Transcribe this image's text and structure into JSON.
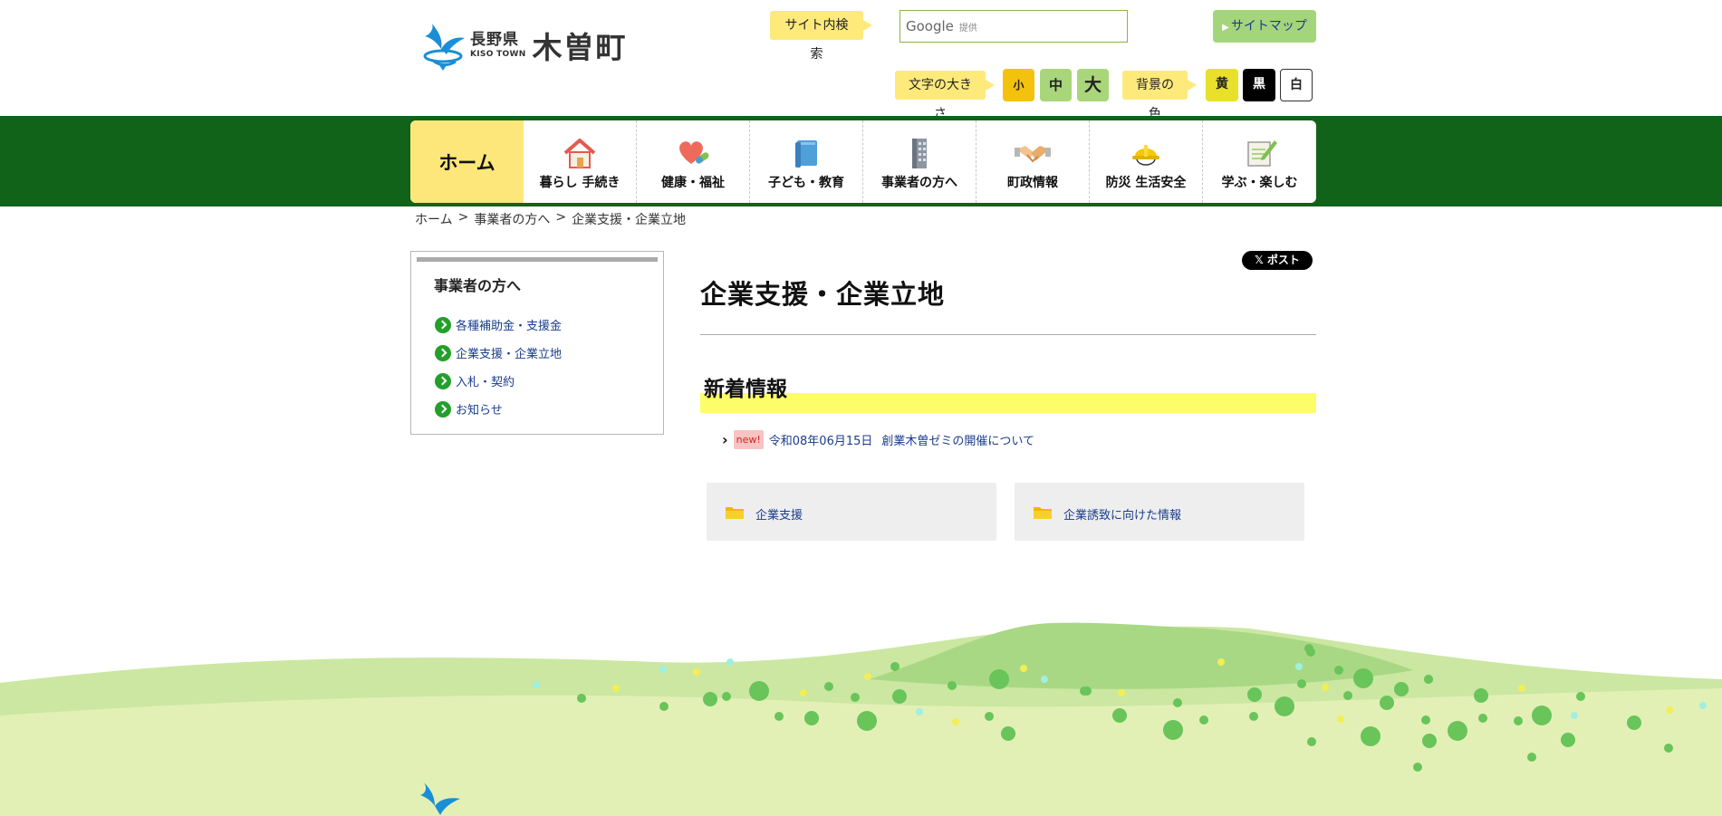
{
  "header": {
    "logo": {
      "prefecture": "長野県",
      "en": "KISO TOWN",
      "town": "木曽町"
    },
    "search": {
      "label": "サイト内検索",
      "google_text": "Google",
      "provided_text": "提供"
    },
    "sitemap_label": "サイトマップ",
    "font_size": {
      "label": "文字の大きさ",
      "small": "小",
      "medium": "中",
      "large": "大"
    },
    "background": {
      "label": "背景の色",
      "yellow": "黄",
      "black": "黒",
      "white": "白"
    }
  },
  "nav": {
    "home": "ホーム",
    "items": [
      {
        "label": "暮らし 手続き",
        "icon": "house-icon"
      },
      {
        "label": "健康・福祉",
        "icon": "heart-pill-icon"
      },
      {
        "label": "子ども・教育",
        "icon": "book-icon"
      },
      {
        "label": "事業者の方へ",
        "icon": "building-icon"
      },
      {
        "label": "町政情報",
        "icon": "handshake-icon"
      },
      {
        "label": "防災 生活安全",
        "icon": "helmet-icon"
      },
      {
        "label": "学ぶ・楽しむ",
        "icon": "notepad-pencil-icon"
      }
    ]
  },
  "breadcrumb": {
    "items": [
      "ホーム",
      "事業者の方へ",
      "企業支援・企業立地"
    ],
    "separator": ">"
  },
  "side": {
    "title": "事業者の方へ",
    "items": [
      "各種補助金・支援金",
      "企業支援・企業立地",
      "入札・契約",
      "お知らせ"
    ]
  },
  "main": {
    "post_button": "ポスト",
    "post_x": "𝕏",
    "title": "企業支援・企業立地",
    "news": {
      "heading": "新着情報",
      "badge": "new!",
      "date": "令和08年06月15日",
      "title": "創業木曽ゼミの開催について"
    },
    "categories": [
      "企業支援",
      "企業誘致に向けた情報"
    ]
  },
  "colors": {
    "nav_band": "#11631a",
    "home_tab": "#fde77b",
    "highlight": "#fdfd6a",
    "link": "#1a3d8c",
    "bullet": "#22a02a"
  }
}
